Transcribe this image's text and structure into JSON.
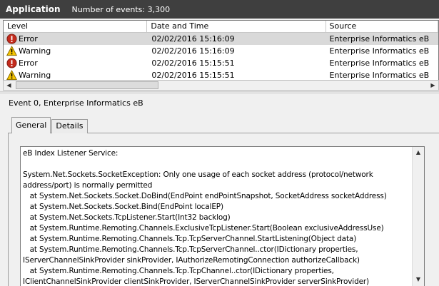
{
  "titlebar": {
    "app_name": "Application",
    "events_text": "Number of events: 3,300"
  },
  "grid": {
    "columns": [
      "Level",
      "Date and Time",
      "Source"
    ],
    "rows": [
      {
        "level": "Error",
        "icon": "error-icon",
        "datetime": "02/02/2016 15:16:09",
        "source": "Enterprise Informatics eB"
      },
      {
        "level": "Warning",
        "icon": "warning-icon",
        "datetime": "02/02/2016 15:16:09",
        "source": "Enterprise Informatics eB"
      },
      {
        "level": "Error",
        "icon": "error-icon",
        "datetime": "02/02/2016 15:15:51",
        "source": "Enterprise Informatics eB"
      },
      {
        "level": "Warning",
        "icon": "warning-icon",
        "datetime": "02/02/2016 15:15:51",
        "source": "Enterprise Informatics eB"
      }
    ]
  },
  "detail": {
    "title": "Event 0, Enterprise Informatics eB",
    "tabs": [
      "General",
      "Details"
    ],
    "message_lines": [
      "eB Index Listener Service:",
      "",
      "System.Net.Sockets.SocketException: Only one usage of each socket address (protocol/network",
      "address/port) is normally permitted",
      "   at System.Net.Sockets.Socket.DoBind(EndPoint endPointSnapshot, SocketAddress socketAddress)",
      "   at System.Net.Sockets.Socket.Bind(EndPoint localEP)",
      "   at System.Net.Sockets.TcpListener.Start(Int32 backlog)",
      "   at System.Runtime.Remoting.Channels.ExclusiveTcpListener.Start(Boolean exclusiveAddressUse)",
      "   at System.Runtime.Remoting.Channels.Tcp.TcpServerChannel.StartListening(Object data)",
      "   at System.Runtime.Remoting.Channels.Tcp.TcpServerChannel..ctor(IDictionary properties,",
      "IServerChannelSinkProvider sinkProvider, IAuthorizeRemotingConnection authorizeCallback)",
      "   at System.Runtime.Remoting.Channels.Tcp.TcpChannel..ctor(IDictionary properties,",
      "IClientChannelSinkProvider clientSinkProvider, IServerChannelSinkProvider serverSinkProvider)"
    ]
  },
  "colors": {
    "titlebar_bg": "#3f3f3f",
    "error_red": "#c42b1c",
    "warning_yellow": "#f5c400",
    "selected_row": "#d9d9d9"
  }
}
